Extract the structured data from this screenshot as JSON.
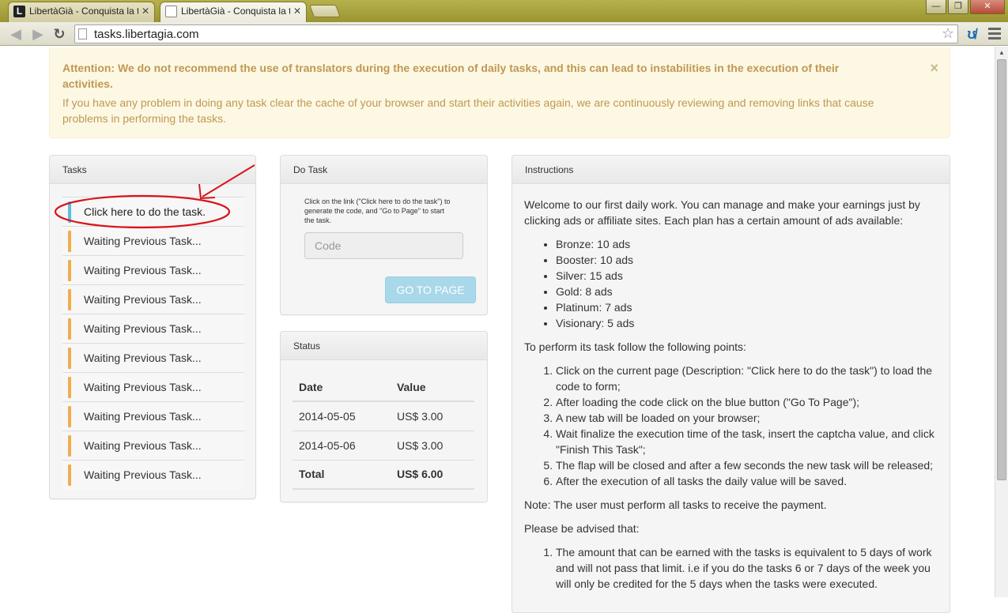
{
  "browser": {
    "tabs": [
      {
        "title": "LibertàGià - Conquista la t",
        "favicon": "L",
        "active": false
      },
      {
        "title": "LibertàGià - Conquista la t",
        "favicon": "page",
        "active": true
      }
    ],
    "url": "tasks.libertagia.com",
    "window_buttons": {
      "minimize": "—",
      "maximize": "❐",
      "close": "✕"
    }
  },
  "alert": {
    "attention": "Attention: We do not recommend the use of translators during the execution of daily tasks, and this can lead to instabilities in the execution of their activities.",
    "message": "If you have any problem in doing any task clear the cache of your browser and start their activities again, we are continuously reviewing and removing links that cause problems in performing the tasks.",
    "close_label": "×"
  },
  "tasks_panel": {
    "title": "Tasks",
    "items": [
      "Click here to do the task.",
      "Waiting Previous Task...",
      "Waiting Previous Task...",
      "Waiting Previous Task...",
      "Waiting Previous Task...",
      "Waiting Previous Task...",
      "Waiting Previous Task...",
      "Waiting Previous Task...",
      "Waiting Previous Task...",
      "Waiting Previous Task..."
    ]
  },
  "do_task_panel": {
    "title": "Do Task",
    "hint": "Click on the link (\"Click here to do the task\") to generate the code, and \"Go to Page\" to start the task.",
    "code_placeholder": "Code",
    "button_label": "GO TO PAGE"
  },
  "status_panel": {
    "title": "Status",
    "headers": [
      "Date",
      "Value"
    ],
    "rows": [
      [
        "2014-05-05",
        "US$ 3.00"
      ],
      [
        "2014-05-06",
        "US$ 3.00"
      ]
    ],
    "total": [
      "Total",
      "US$ 6.00"
    ]
  },
  "instructions_panel": {
    "title": "Instructions",
    "intro": "Welcome to our first daily work. You can manage and make your earnings just by clicking ads or affiliate sites. Each plan has a certain amount of ads available:",
    "plans": [
      "Bronze: 10 ads",
      "Booster: 10 ads",
      "Silver: 15 ads",
      "Gold: 8 ads",
      "Platinum: 7 ads",
      "Visionary: 5 ads"
    ],
    "steps_intro": "To perform its task follow the following points:",
    "steps": [
      "Click on the current page (Description: \"Click here to do the task\") to load the code to form;",
      "After loading the code click on the blue button (\"Go To Page\");",
      "A new tab will be loaded on your browser;",
      "Wait finalize the execution time of the task, insert the captcha value, and click \"Finish This Task\";",
      "The flap will be closed and after a few seconds the new task will be released;",
      "After the execution of all tasks the daily value will be saved."
    ],
    "note": "Note: The user must perform all tasks to receive the payment.",
    "advised": "Please be advised that:",
    "advisories": [
      "The amount that can be earned with the tasks is equivalent to 5 days of work and will not pass that limit. i.e if you do the tasks 6 or 7 days of the week you will only be credited for the 5 days when the tasks were executed."
    ]
  },
  "colors": {
    "alert_bg": "#fcf8e3",
    "alert_text": "#c09853",
    "task_waiting_marker": "#f0ad4e",
    "task_current_marker": "#5bc0de",
    "button_disabled": "#a8d8e9",
    "annotation_red": "#d9141b"
  }
}
